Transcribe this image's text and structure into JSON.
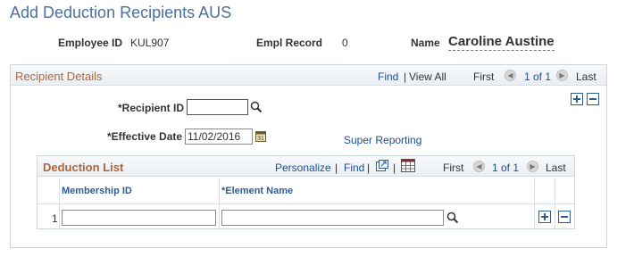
{
  "page": {
    "title": "Add Deduction Recipients AUS"
  },
  "header": {
    "employee_id_label": "Employee ID",
    "employee_id_value": "KUL907",
    "empl_record_label": "Empl Record",
    "empl_record_value": "0",
    "name_label": "Name",
    "name_value": "Caroline Austine"
  },
  "recipient_details": {
    "title": "Recipient Details",
    "nav": {
      "find": "Find",
      "separator": "|",
      "view_all": "View All",
      "first": "First",
      "range": "1 of 1",
      "last": "Last"
    },
    "recipient_id_label": "*Recipient ID",
    "recipient_id_value": "",
    "effective_date_label": "*Effective Date",
    "effective_date_value": "11/02/2016",
    "super_reporting_link": "Super Reporting"
  },
  "deduction_list": {
    "title": "Deduction List",
    "nav": {
      "personalize": "Personalize",
      "separator": "|",
      "find": "Find",
      "first": "First",
      "range": "1 of 1",
      "last": "Last"
    },
    "columns": [
      "Membership ID",
      "*Element Name"
    ],
    "rows": [
      {
        "num": "1",
        "membership_id": "",
        "element_name": ""
      }
    ]
  },
  "icons": {
    "search": "magnifier-icon",
    "calendar": "calendar-icon",
    "prev": "prev-arrow-icon",
    "next": "next-arrow-icon",
    "add": "plus-icon",
    "delete": "minus-icon",
    "zoom": "zoom-grid-icon",
    "download": "download-excel-icon"
  },
  "colors": {
    "title": "#4d6f9e",
    "section_title": "#b0643d",
    "link": "#1f4f8f",
    "column_header": "#2f5d92",
    "border": "#c9d6e2"
  }
}
